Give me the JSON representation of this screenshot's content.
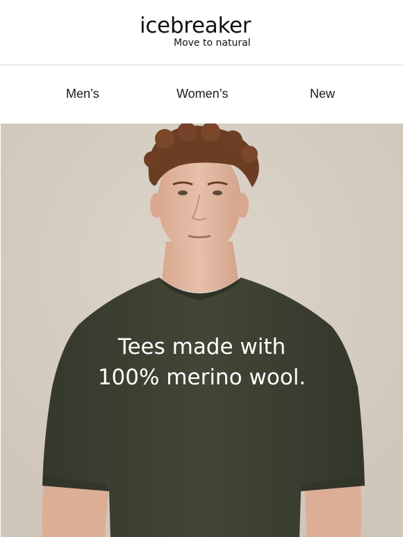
{
  "brand": {
    "name": "icebreaker",
    "tagline": "Move to natural"
  },
  "nav": {
    "items": [
      {
        "label": "Men’s"
      },
      {
        "label": "Women’s"
      },
      {
        "label": "New"
      }
    ]
  },
  "hero": {
    "headline_line1": "Tees made with",
    "headline_line2": "100% merino wool.",
    "image_subject": "man-in-olive-merino-tee",
    "colors": {
      "background": "#d6cdc1",
      "tee": "#3f4233",
      "skin": "#e2b9a2",
      "hair": "#6b3d22"
    }
  }
}
